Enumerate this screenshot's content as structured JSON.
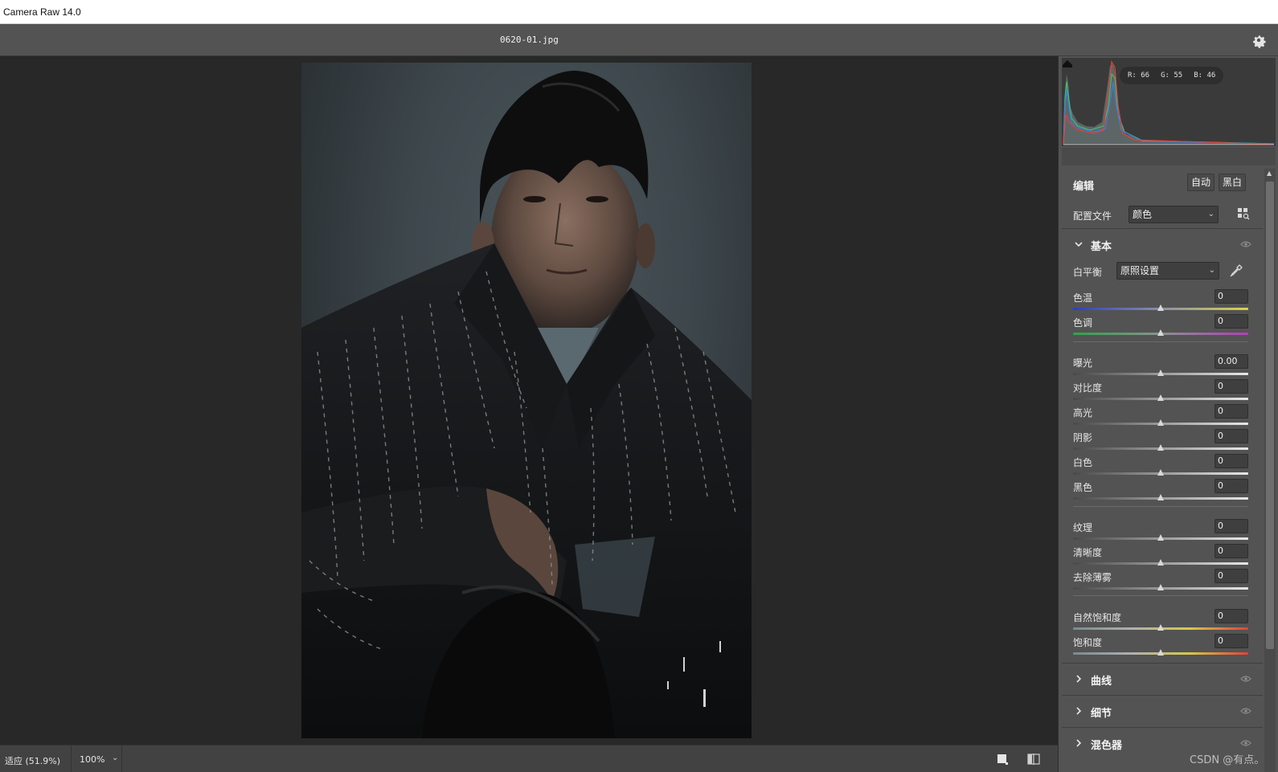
{
  "window": {
    "title": "Camera Raw 14.0"
  },
  "header": {
    "filename": "0620-01.jpg",
    "settings_icon": "gear-icon"
  },
  "statusbar": {
    "fit_label": "适应 (51.9%)",
    "zoom_value": "100%"
  },
  "histogram": {
    "r": "R: 66",
    "g": "G: 55",
    "b": "B: 46"
  },
  "edit": {
    "title": "编辑",
    "auto_label": "自动",
    "bw_label": "黑白",
    "profile_label": "配置文件",
    "profile_value": "颜色"
  },
  "basic": {
    "title": "基本",
    "wb_label": "白平衡",
    "wb_value": "原照设置",
    "sliders": [
      {
        "label": "色温",
        "value": "0",
        "fraction": 0.5,
        "track": "temp"
      },
      {
        "label": "色调",
        "value": "0",
        "fraction": 0.5,
        "track": "tint"
      },
      {
        "label": "曝光",
        "value": "0.00",
        "fraction": 0.5,
        "track": "gray"
      },
      {
        "label": "对比度",
        "value": "0",
        "fraction": 0.5,
        "track": "gray"
      },
      {
        "label": "高光",
        "value": "0",
        "fraction": 0.5,
        "track": "gray"
      },
      {
        "label": "阴影",
        "value": "0",
        "fraction": 0.5,
        "track": "gray"
      },
      {
        "label": "白色",
        "value": "0",
        "fraction": 0.5,
        "track": "gray"
      },
      {
        "label": "黑色",
        "value": "0",
        "fraction": 0.5,
        "track": "gray"
      },
      {
        "label": "纹理",
        "value": "0",
        "fraction": 0.5,
        "track": "gray"
      },
      {
        "label": "清晰度",
        "value": "0",
        "fraction": 0.5,
        "track": "gray"
      },
      {
        "label": "去除薄雾",
        "value": "0",
        "fraction": 0.5,
        "track": "gray"
      },
      {
        "label": "自然饱和度",
        "value": "0",
        "fraction": 0.5,
        "track": "sat"
      },
      {
        "label": "饱和度",
        "value": "0",
        "fraction": 0.5,
        "track": "sat"
      }
    ]
  },
  "sections": [
    {
      "label": "曲线"
    },
    {
      "label": "细节"
    },
    {
      "label": "混色器"
    }
  ],
  "watermark": "CSDN @有点。",
  "colors": {
    "panel_bg": "#535353",
    "canvas_bg": "#282828",
    "hist_red": "#e0413a",
    "hist_green": "#3fbf6a",
    "hist_blue": "#3b7de0"
  }
}
